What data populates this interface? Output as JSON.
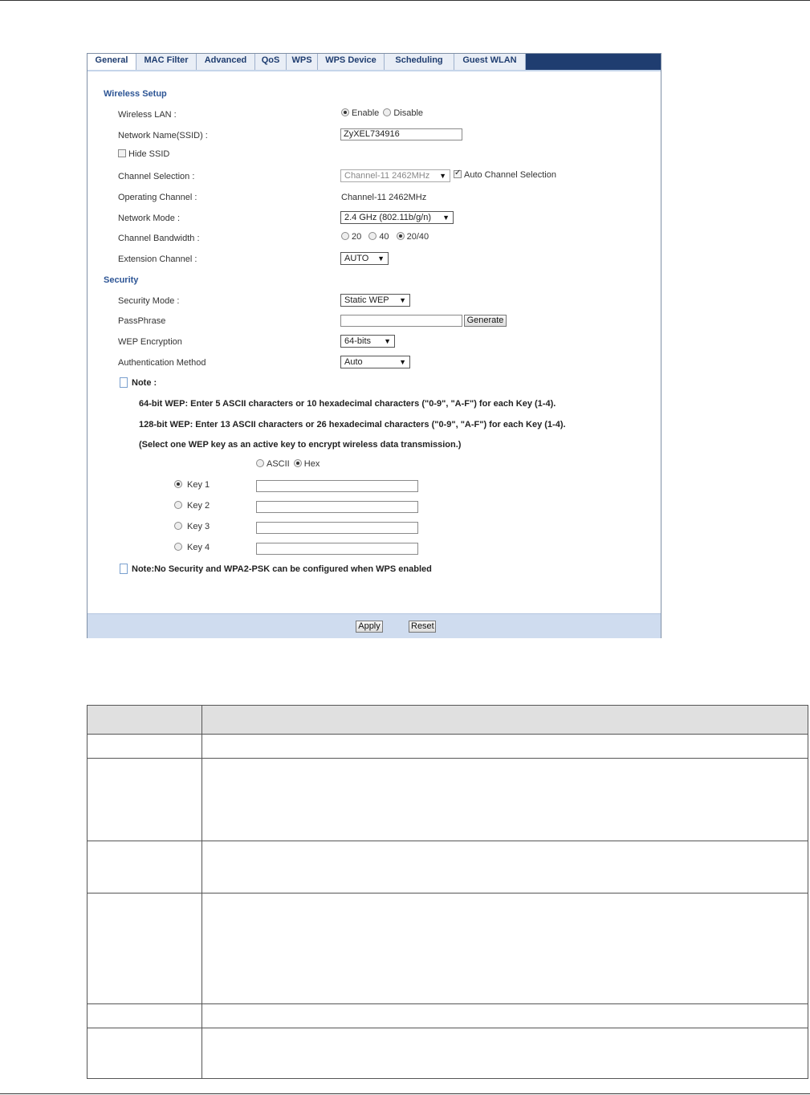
{
  "tabs": [
    {
      "label": "General",
      "active": true
    },
    {
      "label": "MAC Filter"
    },
    {
      "label": "Advanced"
    },
    {
      "label": "QoS"
    },
    {
      "label": "WPS"
    },
    {
      "label": "WPS Device"
    },
    {
      "label": "Scheduling"
    },
    {
      "label": "Guest WLAN"
    }
  ],
  "wireless_setup": {
    "heading": "Wireless Setup",
    "wireless_lan": {
      "label": "Wireless LAN :",
      "enable": "Enable",
      "disable": "Disable",
      "selected": "Enable"
    },
    "ssid": {
      "label": "Network Name(SSID) :",
      "value": "ZyXEL734916"
    },
    "hide_ssid": {
      "label": "Hide SSID",
      "checked": false
    },
    "channel_selection": {
      "label": "Channel Selection :",
      "value": "Channel-11 2462MHz",
      "auto_label": "Auto Channel Selection",
      "auto_checked": true
    },
    "operating_channel": {
      "label": "Operating Channel :",
      "value": "Channel-11 2462MHz"
    },
    "network_mode": {
      "label": "Network Mode :",
      "value": "2.4 GHz (802.11b/g/n)"
    },
    "channel_bandwidth": {
      "label": "Channel Bandwidth :",
      "options": [
        "20",
        "40",
        "20/40"
      ],
      "selected": "20/40"
    },
    "extension_channel": {
      "label": "Extension Channel :",
      "value": "AUTO"
    }
  },
  "security": {
    "heading": "Security",
    "security_mode": {
      "label": "Security Mode :",
      "value": "Static WEP"
    },
    "passphrase": {
      "label": "PassPhrase",
      "value": "",
      "generate": "Generate"
    },
    "wep_encryption": {
      "label": "WEP Encryption",
      "value": "64-bits"
    },
    "auth_method": {
      "label": "Authentication Method",
      "value": "Auto"
    },
    "note_title": "Note :",
    "note_lines": [
      "64-bit WEP: Enter 5 ASCII characters or 10 hexadecimal characters (\"0-9\", \"A-F\") for each Key (1-4).",
      "128-bit WEP: Enter 13 ASCII characters or 26 hexadecimal characters (\"0-9\", \"A-F\") for each Key (1-4).",
      "(Select one WEP key as an active key to encrypt wireless data transmission.)"
    ],
    "key_format": {
      "ascii": "ASCII",
      "hex": "Hex",
      "selected": "Hex"
    },
    "keys": [
      {
        "label": "Key 1",
        "value": "",
        "selected": true
      },
      {
        "label": "Key 2",
        "value": ""
      },
      {
        "label": "Key 3",
        "value": ""
      },
      {
        "label": "Key 4",
        "value": ""
      }
    ],
    "wps_note": "Note:No Security and WPA2-PSK can be configured when WPS enabled"
  },
  "buttons": {
    "apply": "Apply",
    "reset": "Reset"
  }
}
